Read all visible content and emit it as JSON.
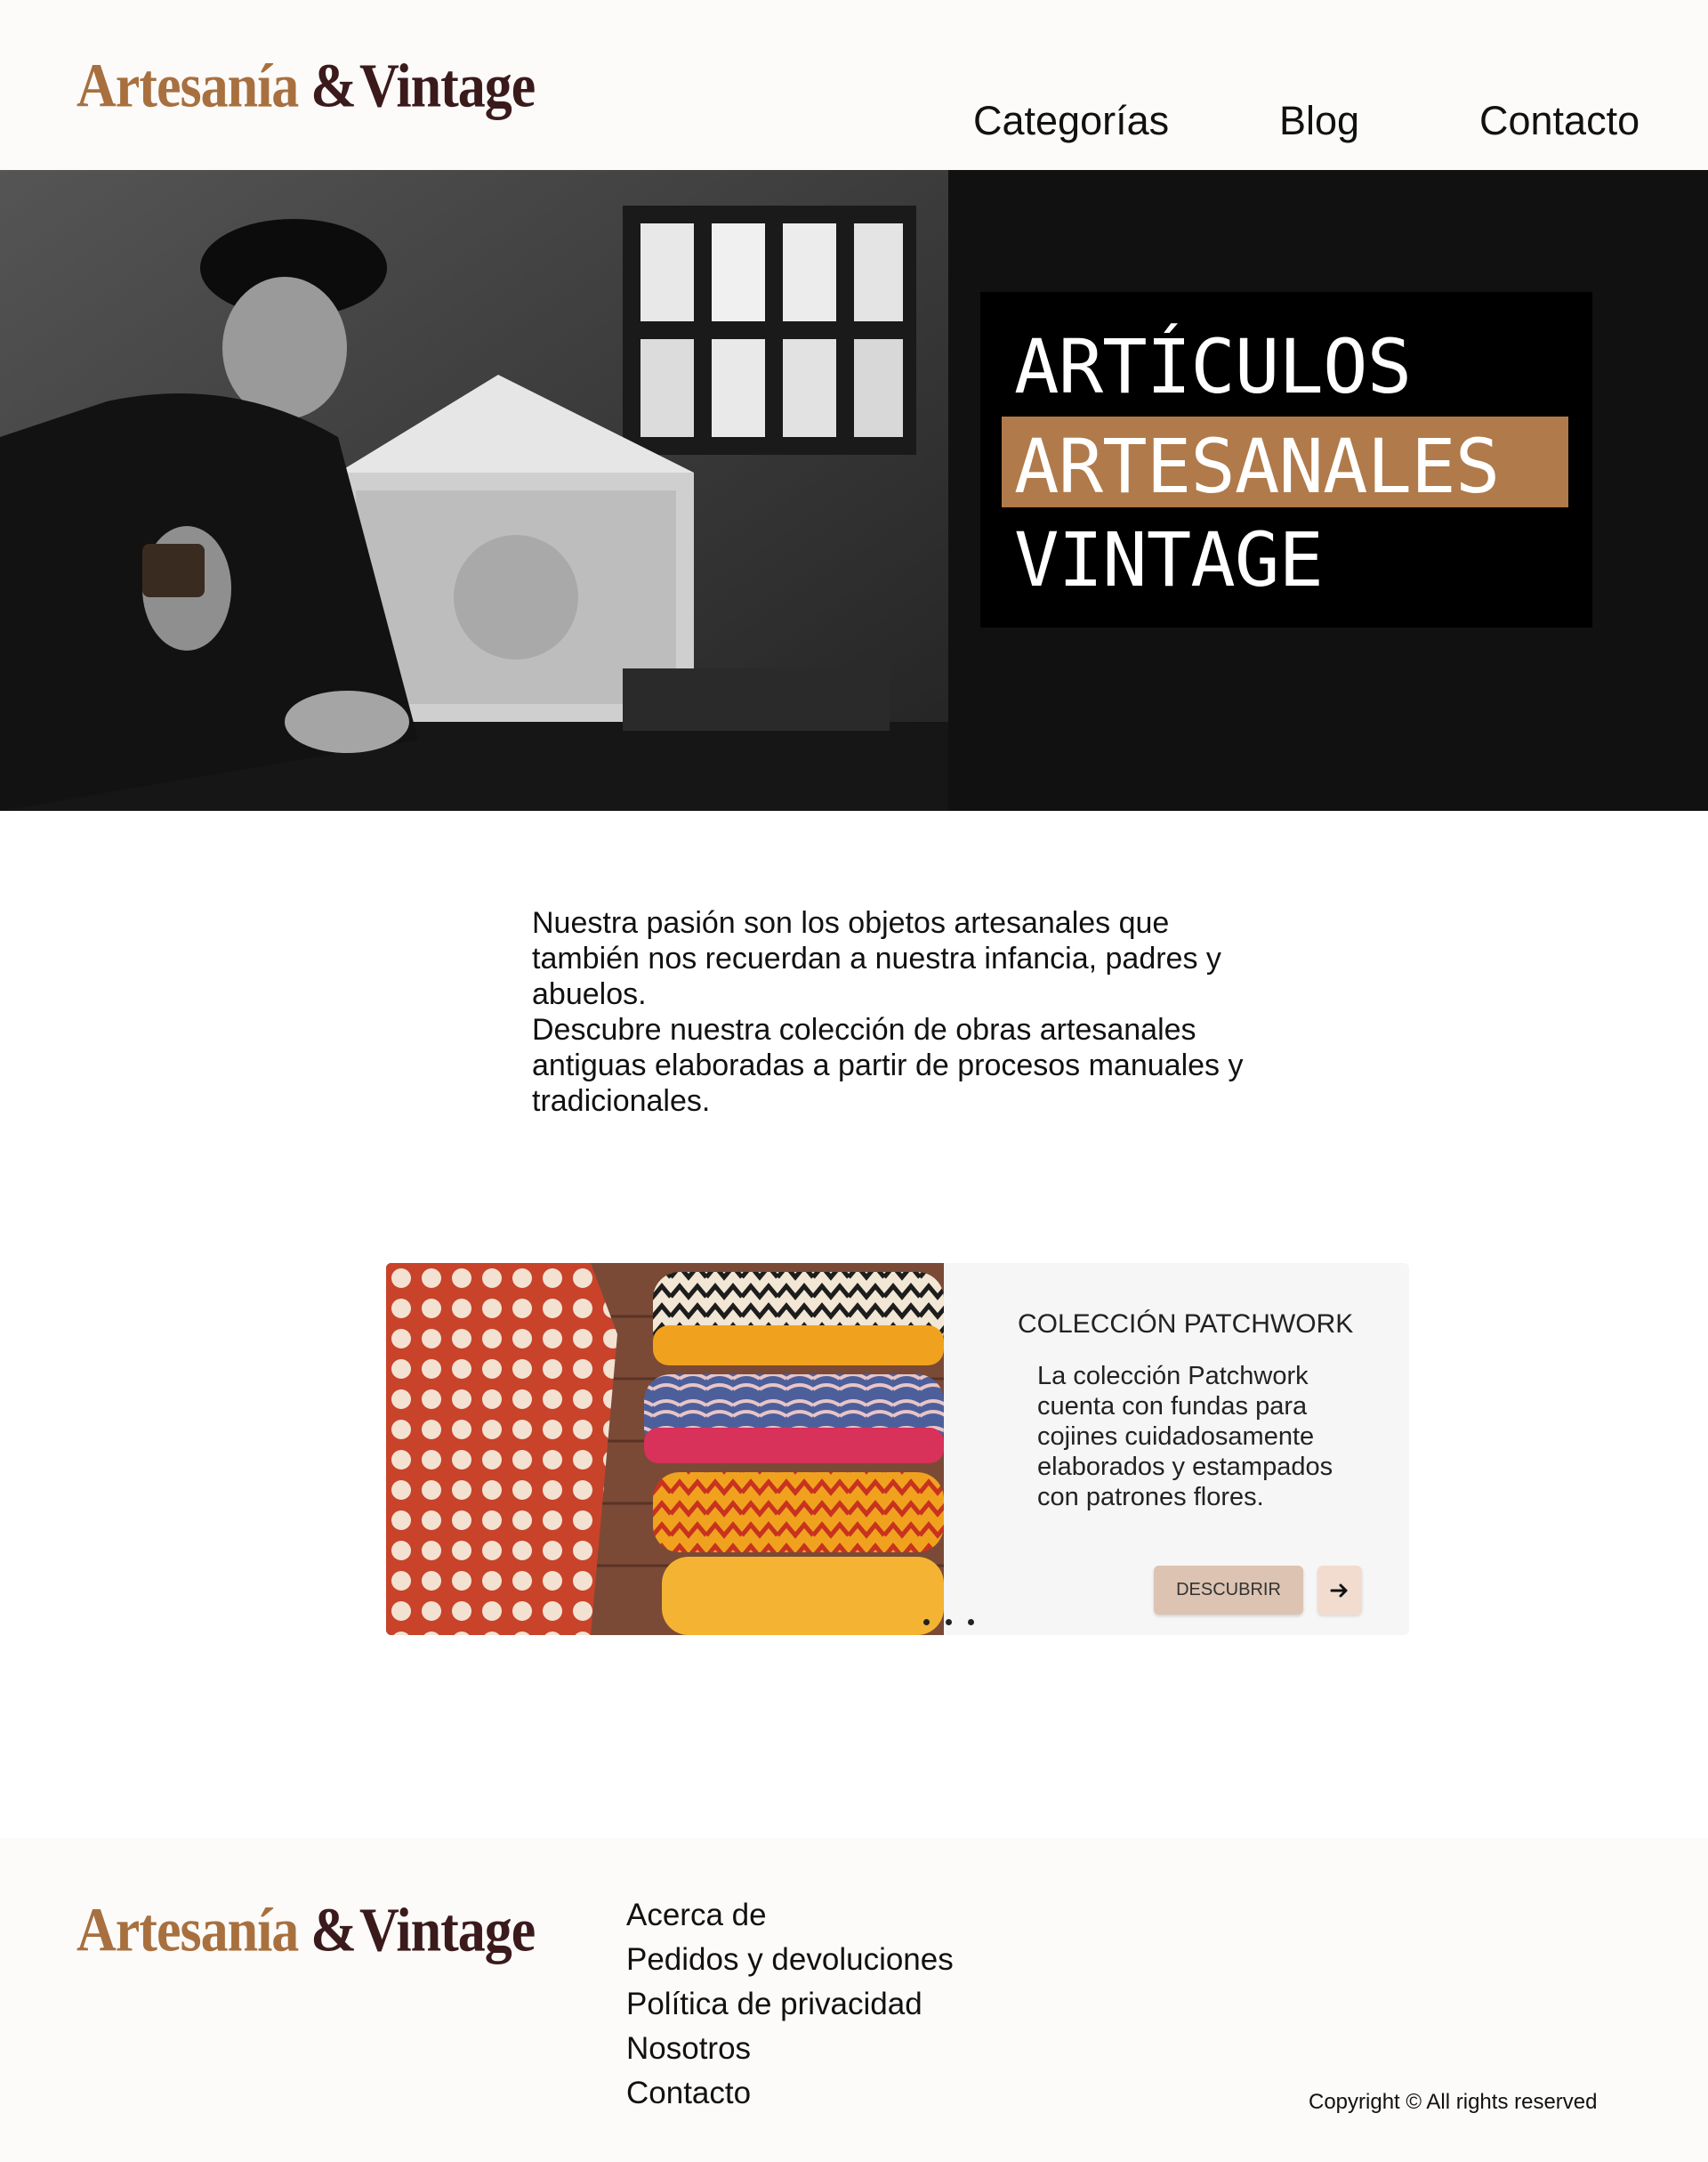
{
  "brand": {
    "word1": "Artesanía",
    "amp": "&",
    "word2": "Vintage"
  },
  "nav": {
    "categories": "Categorías",
    "blog": "Blog",
    "contact": "Contacto"
  },
  "hero": {
    "line1": "ARTÍCULOS",
    "line2": "ARTESANALES",
    "line3": "VINTAGE"
  },
  "intro": {
    "p1": "Nuestra pasión son los objetos artesanales que también nos recuerdan a nuestra infancia, padres y abuelos.",
    "p2": "Descubre nuestra colección de obras artesanales antiguas elaboradas a partir de procesos manuales y tradicionales."
  },
  "card": {
    "title": "COLECCIÓN PATCHWORK",
    "description": "La colección Patchwork cuenta con fundas para cojines cuidadosamente elaborados y estampados con patrones flores.",
    "button": "DESCUBRIR",
    "next_icon": "arrow-right-icon",
    "dots_count": 3
  },
  "footer": {
    "links": [
      "Acerca de",
      "Pedidos y devoluciones",
      "Política de privacidad",
      "Nosotros",
      "Contacto"
    ],
    "copyright": "Copyright © All rights reserved"
  },
  "colors": {
    "accent": "#b07a4a",
    "brand_dark": "#3b1a1c",
    "brand_light": "#a8703f",
    "button": "#dcc3b2"
  }
}
